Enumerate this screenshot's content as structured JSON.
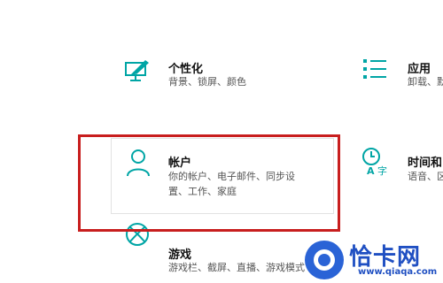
{
  "colors": {
    "accent": "#00a5a5",
    "annotation": "#c81e1e",
    "watermark": "#1f4fc2"
  },
  "tiles": [
    {
      "id": "personalization",
      "icon": "personalization-icon",
      "title": "个性化",
      "desc": "背景、锁屏、颜色"
    },
    {
      "id": "apps",
      "icon": "apps-list-icon",
      "title": "应用",
      "desc": "卸载、默"
    },
    {
      "id": "accounts",
      "icon": "user-icon",
      "title": "帐户",
      "desc_line1": "你的帐户、电子邮件、同步设",
      "desc_line2": "置、工作、家庭"
    },
    {
      "id": "time-language",
      "icon": "time-language-icon",
      "title": "时间和",
      "desc": "语音、区"
    },
    {
      "id": "gaming",
      "icon": "xbox-icon",
      "title": "游戏",
      "desc": "游戏栏、截屏、直播、游戏模式"
    }
  ],
  "watermark": {
    "main": "恰卡网",
    "url": "www.qiaqa.com"
  }
}
